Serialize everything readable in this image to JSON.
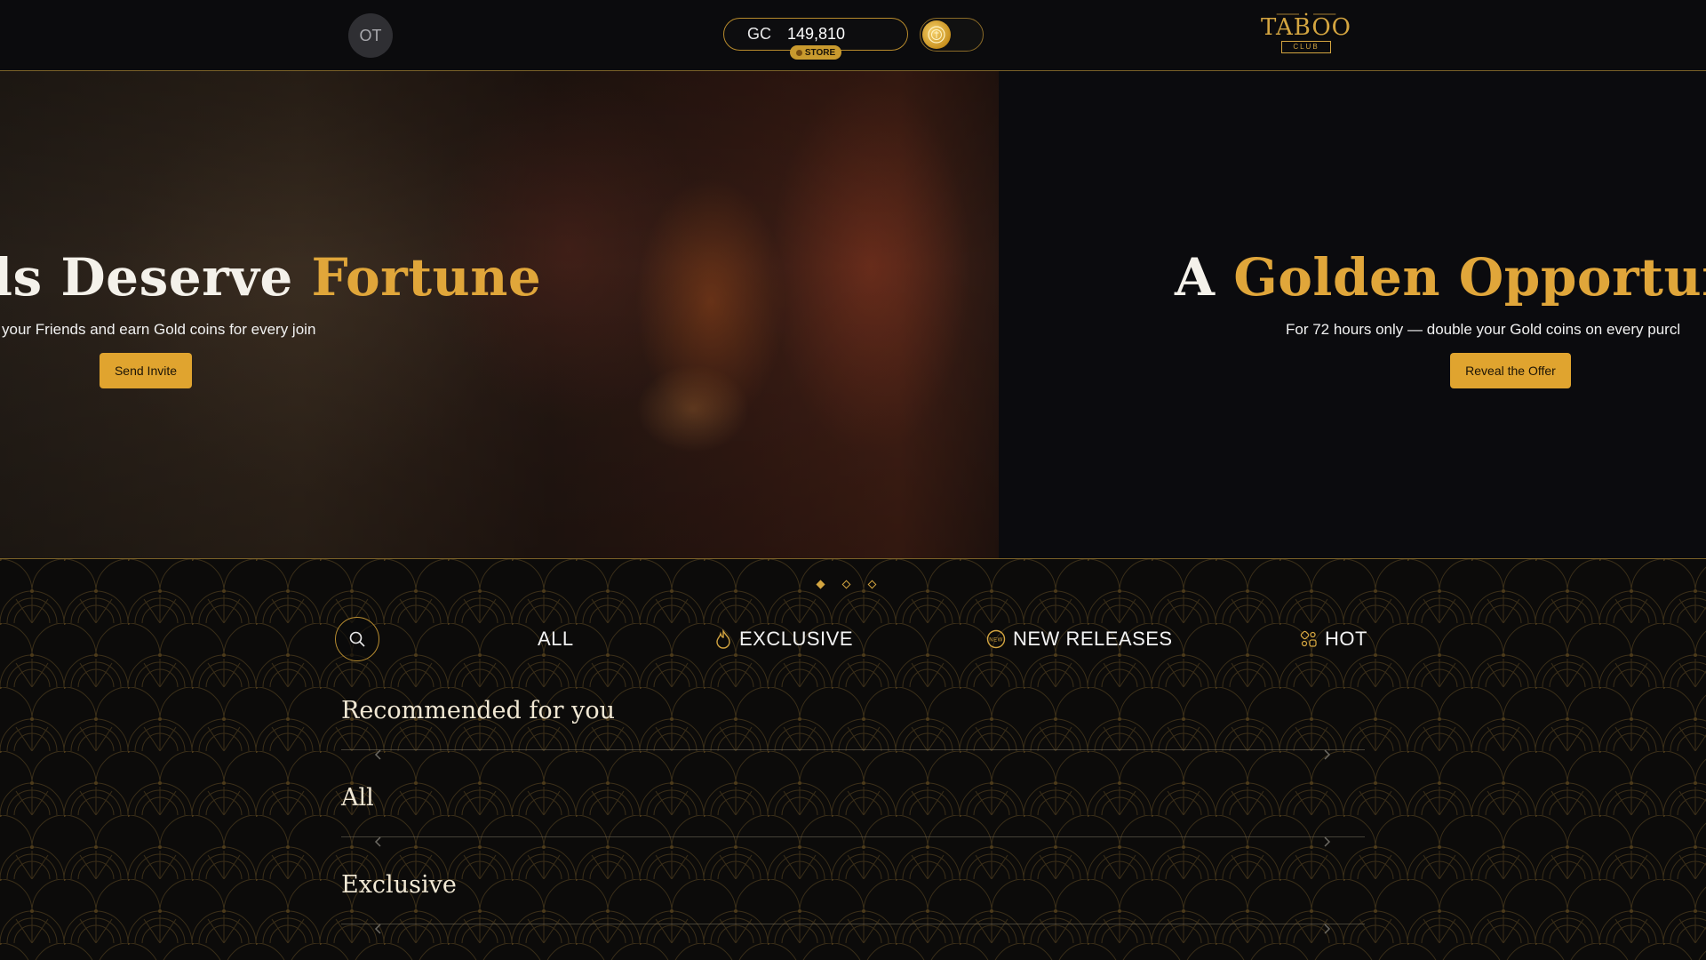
{
  "header": {
    "avatar_initials": "OT",
    "currency": "GC",
    "balance": "149,810",
    "store_label": "STORE",
    "logo_text": "TABOO",
    "logo_sub": "CLUB"
  },
  "hero": {
    "slide1": {
      "title_white": "ls Deserve ",
      "title_gold": "Fortune",
      "subtitle": "your Friends and earn Gold coins for every join",
      "button": "Send Invite"
    },
    "slide2": {
      "title_a": "A ",
      "title_gold": "Golden Opportunity",
      "title_tail": " A",
      "subtitle": "For 72 hours only — double your Gold coins on every purcl",
      "button": "Reveal the Offer"
    },
    "carousel": {
      "count": 3,
      "active_index": 0
    }
  },
  "tabs": [
    {
      "label": "ALL",
      "icon": "none"
    },
    {
      "label": "EXCLUSIVE",
      "icon": "flame-icon"
    },
    {
      "label": "NEW RELEASES",
      "icon": "new-badge-icon"
    },
    {
      "label": "HOT",
      "icon": "dice-icon"
    }
  ],
  "sections": [
    {
      "title": "Recommended for you"
    },
    {
      "title": "All"
    },
    {
      "title": "Exclusive"
    }
  ],
  "colors": {
    "gold": "#e0a63a",
    "background": "#0a0a0c",
    "button": "#e0a42f"
  }
}
